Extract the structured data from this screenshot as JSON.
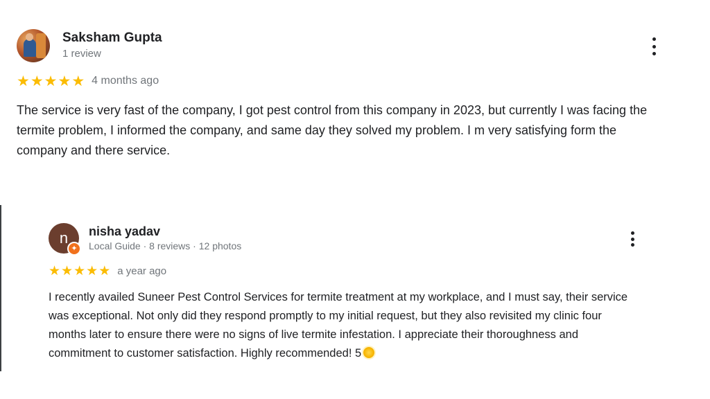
{
  "reviews": [
    {
      "name": "Saksham Gupta",
      "meta": "1 review",
      "rating": 5,
      "time": "4 months ago",
      "text": "The service is very fast of the company, I got pest control from this company in 2023, but currently I was facing the termite problem, I informed the company, and same day they solved my problem. I m very satisfying form the company and there service.",
      "avatar_icon": "user-photo-avatar"
    },
    {
      "name": "nisha yadav",
      "meta": "Local Guide · 8 reviews · 12 photos",
      "avatar_letter": "n",
      "rating": 5,
      "time": "a year ago",
      "text": "I recently availed Suneer Pest Control Services for termite treatment at my workplace, and I must say, their service was exceptional. Not only did they respond promptly to my initial request, but they also revisited my clinic four months later to ensure there were no signs of live termite infestation. I appreciate their thoroughness and commitment to customer satisfaction. Highly recommended! 5",
      "emoji_icon": "sun-emoji-icon",
      "badge_icon": "local-guide-badge-icon"
    }
  ],
  "colors": {
    "star": "#fbbc04",
    "meta_text": "#70757a",
    "body_text": "#202124",
    "avatar_letter_bg": "#6b3e2e",
    "local_guide_badge": "#f1711c"
  },
  "icons": {
    "star": "star-icon",
    "more": "more-vert-icon"
  }
}
